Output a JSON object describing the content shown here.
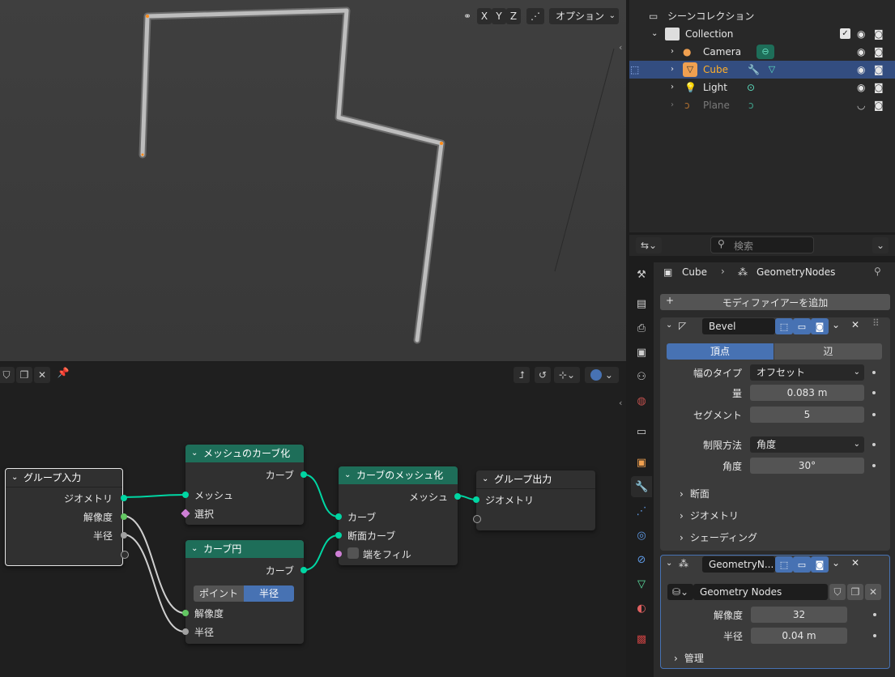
{
  "viewport": {
    "axis_x": "X",
    "axis_y": "Y",
    "axis_z": "Z",
    "options_label": "オプション"
  },
  "node_editor": {
    "nodes": {
      "group_input": {
        "title": "グループ入力",
        "geometry": "ジオメトリ",
        "resolution": "解像度",
        "radius": "半径"
      },
      "mesh_to_curve": {
        "title": "メッシュのカーブ化",
        "out_curve": "カーブ",
        "in_mesh": "メッシュ",
        "in_selection": "選択"
      },
      "curve_to_mesh": {
        "title": "カーブのメッシュ化",
        "out_mesh": "メッシュ",
        "in_curve": "カーブ",
        "in_profile": "断面カーブ",
        "fill_caps": "端をフィル"
      },
      "group_output": {
        "title": "グループ出力",
        "geometry": "ジオメトリ"
      },
      "curve_circle": {
        "title": "カーブ円",
        "out_curve": "カーブ",
        "mode_points": "ポイント",
        "mode_radius": "半径",
        "in_resolution": "解像度",
        "in_radius": "半径"
      }
    }
  },
  "outliner": {
    "scene_collection": "シーンコレクション",
    "collection": "Collection",
    "items": [
      {
        "name": "Camera"
      },
      {
        "name": "Cube"
      },
      {
        "name": "Light"
      },
      {
        "name": "Plane"
      }
    ]
  },
  "properties": {
    "search_placeholder": "検索",
    "breadcrumb_object": "Cube",
    "breadcrumb_modifier": "GeometryNodes",
    "add_modifier": "モディファイアーを追加",
    "bevel": {
      "name": "Bevel",
      "tab_vertex": "頂点",
      "tab_edge": "辺",
      "width_type_label": "幅のタイプ",
      "width_type_value": "オフセット",
      "amount_label": "量",
      "amount_value": "0.083 m",
      "segments_label": "セグメント",
      "segments_value": "5",
      "limit_method_label": "制限方法",
      "limit_method_value": "角度",
      "angle_label": "角度",
      "angle_value": "30°",
      "section_profile": "断面",
      "section_geometry": "ジオメトリ",
      "section_shading": "シェーディング"
    },
    "geonodes": {
      "name": "GeometryN...",
      "tree_name": "Geometry Nodes",
      "resolution_label": "解像度",
      "resolution_value": "32",
      "radius_label": "半径",
      "radius_value": "0.04 m",
      "section_manage": "管理"
    }
  },
  "colors": {
    "accent_blue": "#4772b3",
    "node_header_green": "#1e6e59",
    "socket_geometry": "#00d6a3",
    "selected_row": "#334d80"
  }
}
